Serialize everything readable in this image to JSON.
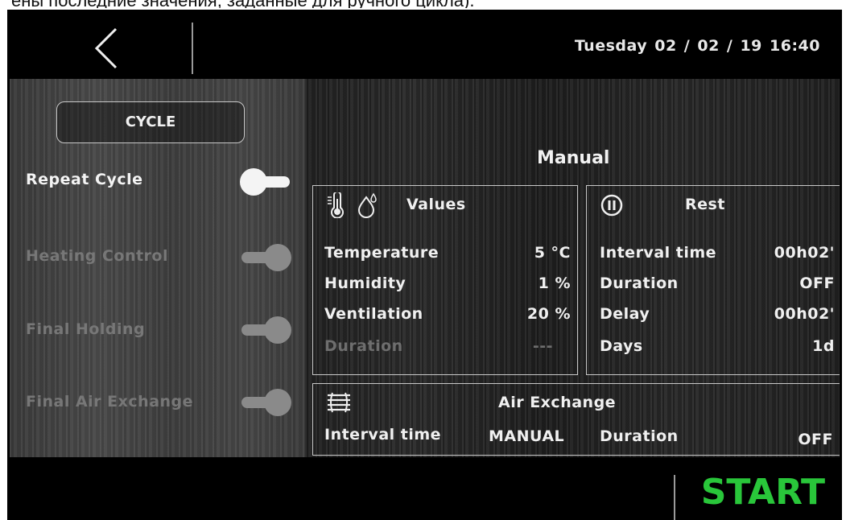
{
  "caption": "ены последние значения, заданные для ручного цикла).",
  "header": {
    "back_icon": "chevron-left-icon",
    "datetime": "Tuesday 02 / 02 / 19  16:40"
  },
  "left_panel": {
    "cycle_button": "CYCLE",
    "options": [
      {
        "label": "Repeat Cycle",
        "state": "off",
        "enabled": true
      },
      {
        "label": "Heating Control",
        "state": "on",
        "enabled": false
      },
      {
        "label": "Final Holding",
        "state": "on",
        "enabled": false
      },
      {
        "label": "Final Air Exchange",
        "state": "on",
        "enabled": false
      }
    ]
  },
  "main": {
    "mode": "Manual",
    "values_panel": {
      "title": "Values",
      "icons": [
        "thermometer-icon",
        "humidity-icon"
      ],
      "rows": [
        {
          "label": "Temperature",
          "value": "5 °C",
          "enabled": true
        },
        {
          "label": "Humidity",
          "value": "1 %",
          "enabled": true
        },
        {
          "label": "Ventilation",
          "value": "20 %",
          "enabled": true
        },
        {
          "label": "Duration",
          "value": "---",
          "enabled": false
        }
      ]
    },
    "rest_panel": {
      "title": "Rest",
      "icon": "pause-icon",
      "rows": [
        {
          "label": "Interval time",
          "value": "00h02'"
        },
        {
          "label": "Duration",
          "value": "OFF"
        },
        {
          "label": "Delay",
          "value": "00h02'"
        },
        {
          "label": "Days",
          "value": "1d"
        }
      ]
    },
    "air_panel": {
      "title": "Air Exchange",
      "icon": "air-exchange-icon",
      "interval_label": "Interval time",
      "interval_value": "MANUAL",
      "duration_label": "Duration",
      "duration_value": "OFF"
    }
  },
  "footer": {
    "start_label": "START",
    "start_color": "#29c63a"
  }
}
